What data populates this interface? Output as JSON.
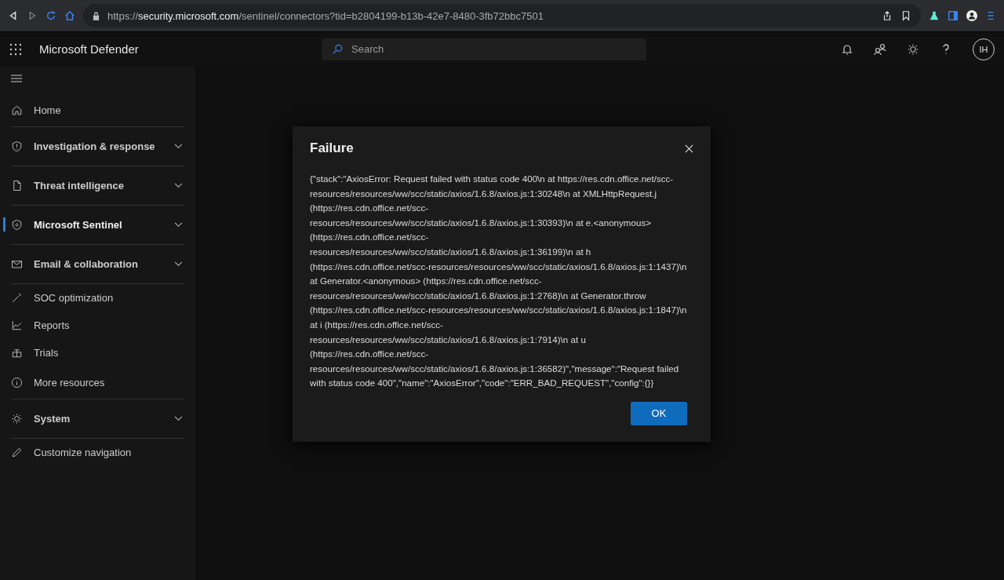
{
  "browser": {
    "url": {
      "prefix": "https://",
      "host": "security.microsoft.com",
      "path": "/sentinel/connectors?tid=b2804199-b13b-42e7-8480-3fb72bbc7501"
    }
  },
  "header": {
    "app_name": "Microsoft Defender",
    "search": {
      "placeholder": "Search"
    },
    "avatar": "IH"
  },
  "sidebar": {
    "items": [
      {
        "label": "Home",
        "kind": "item",
        "selected": false,
        "separator": true
      },
      {
        "label": "Investigation & response",
        "kind": "group",
        "selected": false,
        "separator": true
      },
      {
        "label": "Threat intelligence",
        "kind": "group",
        "selected": false,
        "separator": true
      },
      {
        "label": "Microsoft Sentinel",
        "kind": "group",
        "selected": true,
        "separator": true
      },
      {
        "label": "Email & collaboration",
        "kind": "group",
        "selected": false,
        "separator": true
      },
      {
        "label": "SOC optimization",
        "kind": "item",
        "selected": false,
        "separator": false
      },
      {
        "label": "Reports",
        "kind": "item",
        "selected": false,
        "separator": false
      },
      {
        "label": "Trials",
        "kind": "item",
        "selected": false,
        "separator": false
      },
      {
        "label": "More resources",
        "kind": "item",
        "selected": false,
        "separator": true
      },
      {
        "label": "System",
        "kind": "group",
        "selected": false,
        "separator": true
      },
      {
        "label": "Customize navigation",
        "kind": "item",
        "selected": false,
        "separator": false
      }
    ]
  },
  "dialog": {
    "title": "Failure",
    "message": "{\"stack\":\"AxiosError: Request failed with status code 400\\n at https://res.cdn.office.net/scc-resources/resources/ww/scc/static/axios/1.6.8/axios.js:1:30248\\n at XMLHttpRequest.j (https://res.cdn.office.net/scc-resources/resources/ww/scc/static/axios/1.6.8/axios.js:1:30393)\\n at e.<anonymous> (https://res.cdn.office.net/scc-resources/resources/ww/scc/static/axios/1.6.8/axios.js:1:36199)\\n at h (https://res.cdn.office.net/scc-resources/resources/ww/scc/static/axios/1.6.8/axios.js:1:1437)\\n at Generator.<anonymous> (https://res.cdn.office.net/scc-resources/resources/ww/scc/static/axios/1.6.8/axios.js:1:2768)\\n at Generator.throw (https://res.cdn.office.net/scc-resources/resources/ww/scc/static/axios/1.6.8/axios.js:1:1847)\\n at i (https://res.cdn.office.net/scc-resources/resources/ww/scc/static/axios/1.6.8/axios.js:1:7914)\\n at u (https://res.cdn.office.net/scc-resources/resources/ww/scc/static/axios/1.6.8/axios.js:1:36582)\",\"message\":\"Request failed with status code 400\",\"name\":\"AxiosError\",\"code\":\"ERR_BAD_REQUEST\",\"config\":{}}",
    "button": "OK"
  }
}
